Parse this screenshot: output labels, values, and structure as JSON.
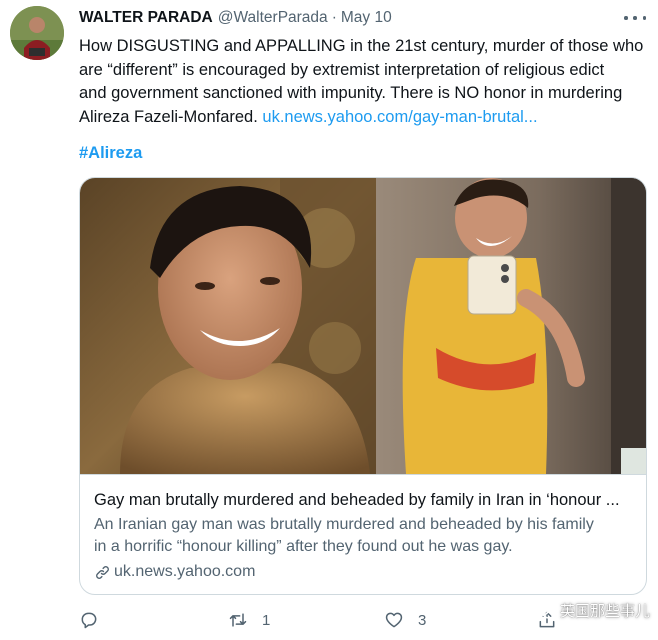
{
  "author": {
    "name": "WALTER PARADA",
    "handle": "@WalterParada",
    "separator": "·",
    "date": "May 10"
  },
  "tweet": {
    "text_lines": [
      "How DISGUSTING and APPALLING in the 21st century, murder of those who",
      "are “different” is encouraged by extremist interpretation of religious edict",
      "and government sanctioned with impunity. There is NO honor in murdering"
    ],
    "last_line_text": "Alireza Fazeli-Monfared. ",
    "link_text": "uk.news.yahoo.com/gay-man-brutal...",
    "hashtag": "#Alireza"
  },
  "card": {
    "title": "Gay man brutally murdered and beheaded by family in Iran in ‘honour ...",
    "description_lines": [
      "An Iranian gay man was brutally murdered and beheaded by his family",
      "in a horrific “honour killing” after they found out he was gay."
    ],
    "domain": "uk.news.yahoo.com"
  },
  "actions": {
    "reply_icon": "reply-icon",
    "retweet_icon": "retweet-icon",
    "retweet_count": "1",
    "like_icon": "heart-icon",
    "like_count": "3",
    "share_icon": "share-icon"
  },
  "watermark": {
    "text": "英国那些事儿",
    "icon": "wechat-icon"
  },
  "colors": {
    "link": "#1d9bf0",
    "secondary_text": "#536471",
    "primary_text": "#0f1419",
    "border": "#cfd9de"
  }
}
